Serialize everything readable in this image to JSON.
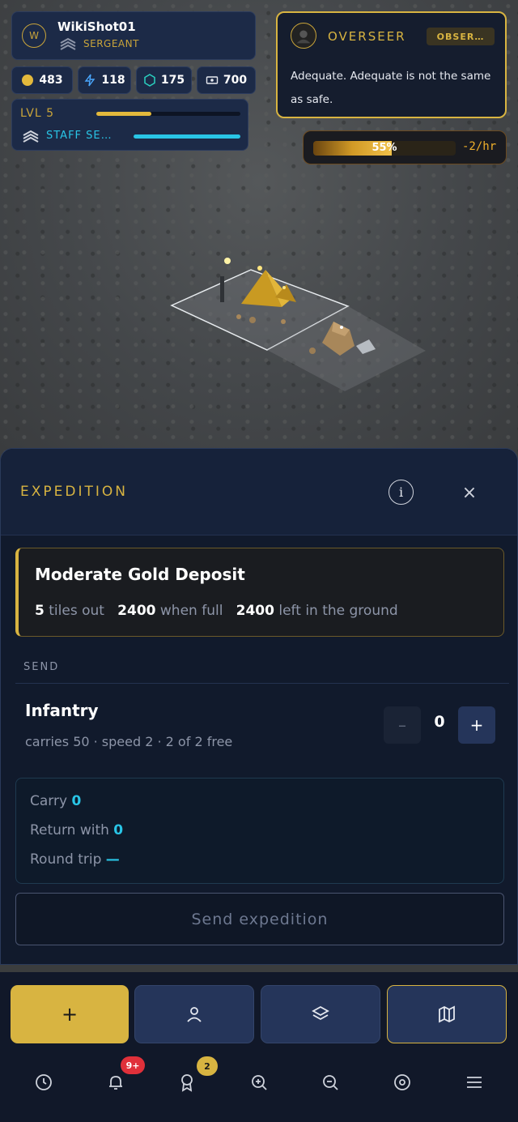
{
  "profile": {
    "avatar_letter": "W",
    "username": "WikiShot01",
    "rank": "SERGEANT"
  },
  "resources": [
    {
      "icon": "gold-coin-icon",
      "value": "483",
      "color": "#e3b93c"
    },
    {
      "icon": "lightning-icon",
      "value": "118",
      "color": "#4aa8ff"
    },
    {
      "icon": "hexagon-icon",
      "value": "175",
      "color": "#2ad1c0"
    },
    {
      "icon": "ticket-icon",
      "value": "700",
      "color": "#e6e9f0"
    }
  ],
  "level": {
    "label": "LVL 5",
    "progress": 0.38,
    "staff_label": "STAFF SE…",
    "staff_progress": 1.0
  },
  "overseer": {
    "title": "OVERSEER",
    "badge": "OBSER…",
    "message": "Adequate. Adequate is not the same as safe."
  },
  "morale": {
    "percent_label": "55%",
    "percent": 0.55,
    "rate": "-2/hr"
  },
  "expedition": {
    "title": "EXPEDITION",
    "info_label": "i",
    "close_label": "×",
    "deposit": {
      "name": "Moderate Gold Deposit",
      "distance_value": "5",
      "distance_text": "tiles out",
      "capacity_value": "2400",
      "capacity_text": "when full",
      "remaining_value": "2400",
      "remaining_text": "left in the ground"
    },
    "send_label": "SEND",
    "unit": {
      "name": "Infantry",
      "description": "carries 50 · speed 2 · 2 of 2 free",
      "count": "0",
      "minus": "–",
      "plus": "+"
    },
    "summary": {
      "carry_label": "Carry",
      "carry_value": "0",
      "return_label": "Return with",
      "return_value": "0",
      "trip_label": "Round trip",
      "trip_value": "—"
    },
    "send_button": "Send expedition"
  },
  "actions": [
    {
      "icon": "plus-icon",
      "label": "+"
    },
    {
      "icon": "person-icon"
    },
    {
      "icon": "layers-icon"
    },
    {
      "icon": "map-icon"
    }
  ],
  "nav": {
    "notifications_badge": "9+",
    "achievements_badge": "2"
  },
  "colors": {
    "gold": "#d8b441",
    "cyan": "#29c5e6",
    "panel": "#1c2a47"
  }
}
